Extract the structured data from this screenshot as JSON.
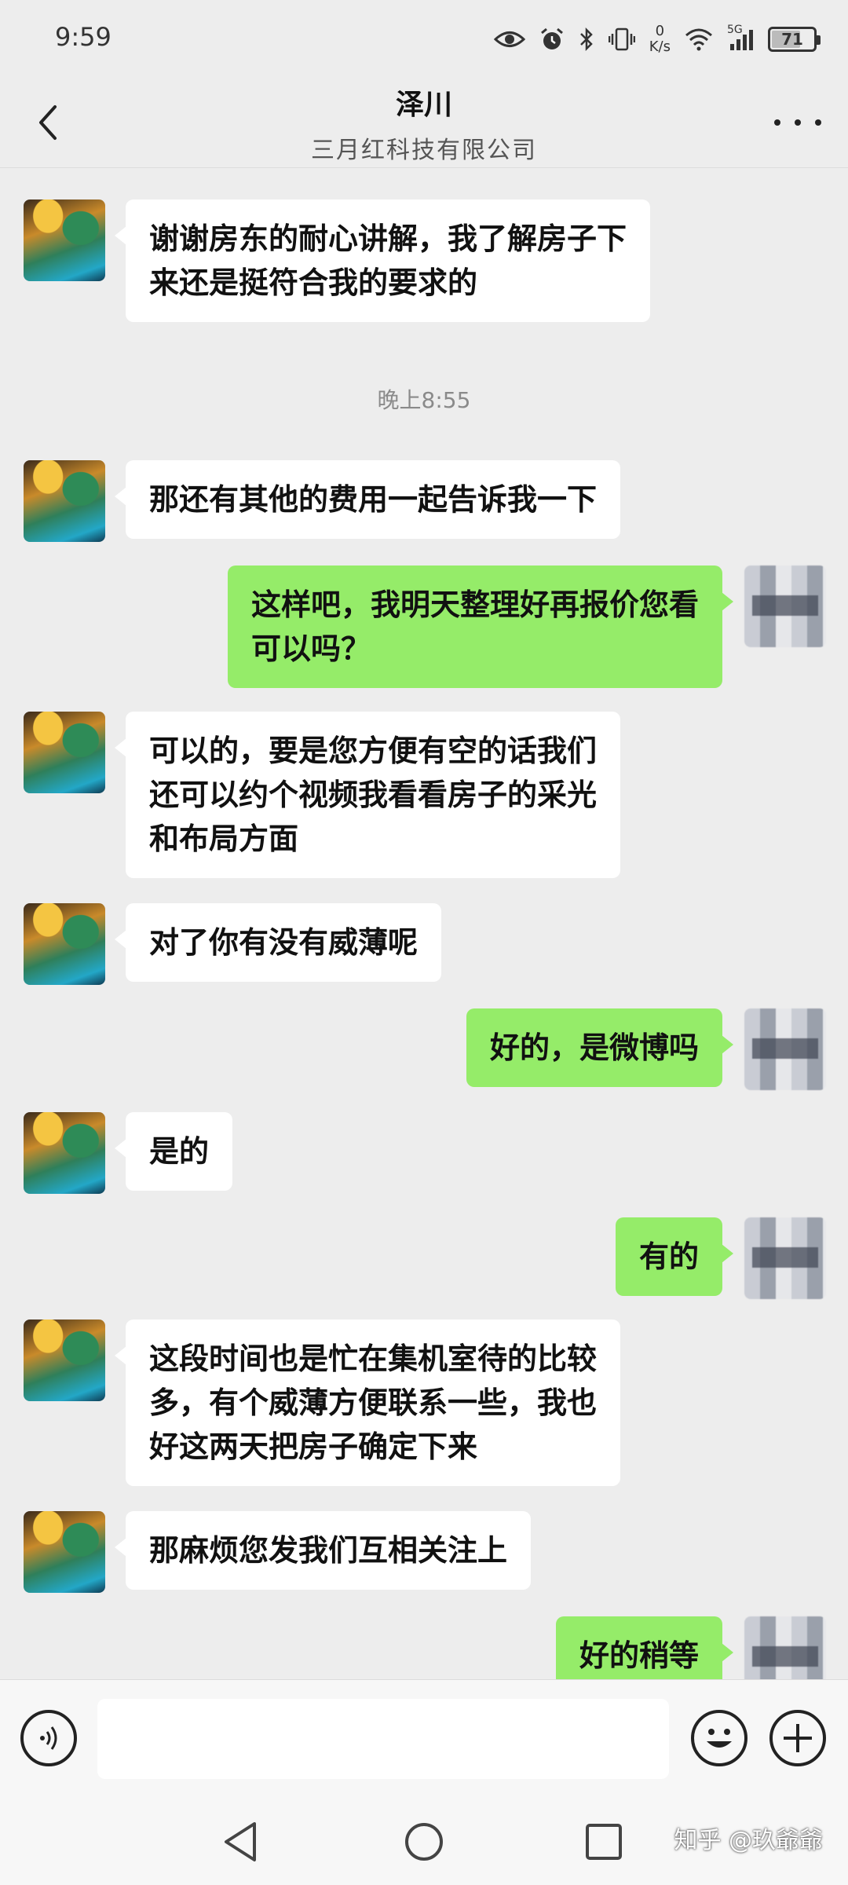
{
  "status_bar": {
    "time": "9:59",
    "net_speed_value": "0",
    "net_speed_unit": "K/s",
    "signal_label": "5G",
    "battery": "71",
    "battery_level": 0.71,
    "icons": [
      "eye-icon",
      "alarm-icon",
      "bluetooth-icon",
      "vibrate-icon",
      "wifi-icon",
      "signal-icon",
      "battery-icon"
    ]
  },
  "header": {
    "title": "泽川",
    "subtitle": "三月红科技有限公司",
    "back_icon": "chevron-left-icon",
    "more_icon": "more-dots-icon"
  },
  "messages": [
    {
      "side": "left",
      "text": "谢谢房东的耐心讲解，我了解房子下\n来还是挺符合我的要求的"
    },
    {
      "type": "timestamp",
      "text": "晚上8:55"
    },
    {
      "side": "left",
      "text": "那还有其他的费用一起告诉我一下"
    },
    {
      "side": "right",
      "text": "这样吧，我明天整理好再报价您看\n可以吗？"
    },
    {
      "side": "left",
      "text": "可以的，要是您方便有空的话我们\n还可以约个视频我看看房子的采光\n和布局方面"
    },
    {
      "side": "left",
      "text": "对了你有没有威薄呢"
    },
    {
      "side": "right",
      "text": "好的，是微博吗"
    },
    {
      "side": "left",
      "text": "是的"
    },
    {
      "side": "right",
      "text": "有的"
    },
    {
      "side": "left",
      "text": "这段时间也是忙在集机室待的比较\n多，有个威薄方便联系一些，我也\n好这两天把房子确定下来"
    },
    {
      "side": "left",
      "text": "那麻烦您发我们互相关注上"
    },
    {
      "side": "right",
      "text": "好的稍等"
    }
  ],
  "input_bar": {
    "placeholder": "",
    "value": "",
    "voice_icon": "voice-icon",
    "emoji_icon": "emoji-icon",
    "plus_icon": "plus-icon"
  },
  "nav_bar": {
    "back_icon": "nav-back-icon",
    "home_icon": "nav-home-icon",
    "recents_icon": "nav-recents-icon",
    "watermark": "知乎 @玖爺爺"
  },
  "colors": {
    "background": "#ededed",
    "bubble_self": "#95ec69",
    "bubble_other": "#ffffff"
  }
}
